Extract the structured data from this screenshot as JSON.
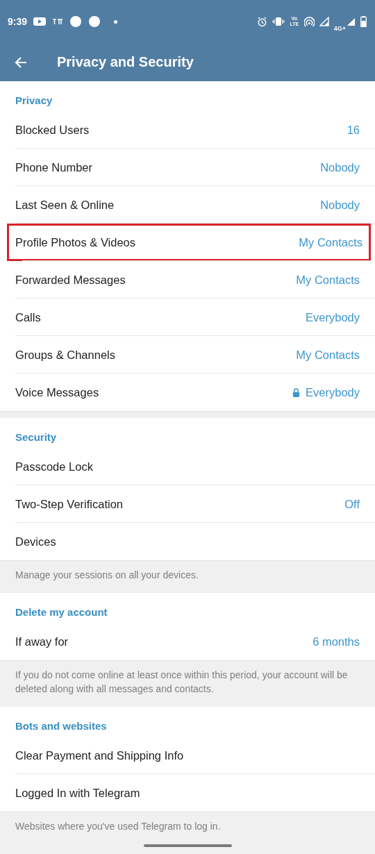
{
  "status_bar": {
    "time": "9:39",
    "network": "4G+",
    "volte": "Vo LTE"
  },
  "app_bar": {
    "title": "Privacy and Security"
  },
  "sections": [
    {
      "header": "Privacy",
      "rows": [
        {
          "label": "Blocked Users",
          "value": "16",
          "highlighted": false,
          "locked": false
        },
        {
          "label": "Phone Number",
          "value": "Nobody",
          "highlighted": false,
          "locked": false
        },
        {
          "label": "Last Seen & Online",
          "value": "Nobody",
          "highlighted": false,
          "locked": false
        },
        {
          "label": "Profile Photos & Videos",
          "value": "My Contacts",
          "highlighted": true,
          "locked": false
        },
        {
          "label": "Forwarded Messages",
          "value": "My Contacts",
          "highlighted": false,
          "locked": false
        },
        {
          "label": "Calls",
          "value": "Everybody",
          "highlighted": false,
          "locked": false
        },
        {
          "label": "Groups & Channels",
          "value": "My Contacts",
          "highlighted": false,
          "locked": false
        },
        {
          "label": "Voice Messages",
          "value": "Everybody",
          "highlighted": false,
          "locked": true
        }
      ]
    },
    {
      "header": "Security",
      "rows": [
        {
          "label": "Passcode Lock",
          "highlighted": false
        },
        {
          "label": "Two-Step Verification",
          "value": "Off",
          "highlighted": false,
          "locked": false
        },
        {
          "label": "Devices",
          "highlighted": false
        }
      ],
      "info": "Manage your sessions on all your devices."
    },
    {
      "header": "Delete my account",
      "rows": [
        {
          "label": "If away for",
          "value": "6 months",
          "highlighted": false,
          "locked": false
        }
      ],
      "info": "If you do not come online at least once within this period, your account will be deleted along with all messages and contacts."
    },
    {
      "header": "Bots and websites",
      "rows": [
        {
          "label": "Clear Payment and Shipping Info",
          "highlighted": false
        },
        {
          "label": "Logged In with Telegram",
          "highlighted": false
        }
      ],
      "info": "Websites where you've used Telegram to log in."
    }
  ]
}
